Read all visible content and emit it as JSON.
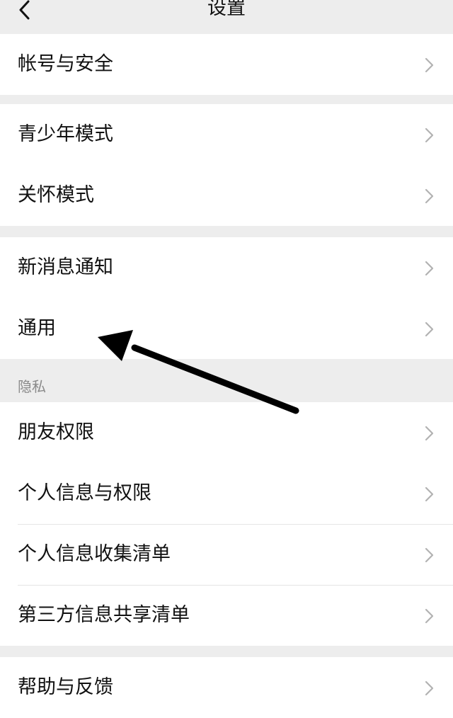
{
  "nav": {
    "title": "设置",
    "back_icon": "chevron-left-icon"
  },
  "groups": [
    {
      "items": [
        {
          "label": "帐号与安全"
        }
      ]
    },
    {
      "items": [
        {
          "label": "青少年模式"
        },
        {
          "label": "关怀模式"
        }
      ]
    },
    {
      "items": [
        {
          "label": "新消息通知"
        },
        {
          "label": "通用"
        }
      ]
    },
    {
      "header": "隐私",
      "items": [
        {
          "label": "朋友权限"
        },
        {
          "label": "个人信息与权限"
        },
        {
          "label": "个人信息收集清单"
        },
        {
          "label": "第三方信息共享清单"
        }
      ]
    },
    {
      "items": [
        {
          "label": "帮助与反馈"
        }
      ]
    }
  ],
  "annotation": {
    "icon": "arrow-icon",
    "color": "#000000"
  },
  "colors": {
    "background": "#ededed",
    "surface": "#ffffff",
    "chevron": "#b2b2b2",
    "text": "#111111",
    "secondary": "#8a8a8a"
  }
}
